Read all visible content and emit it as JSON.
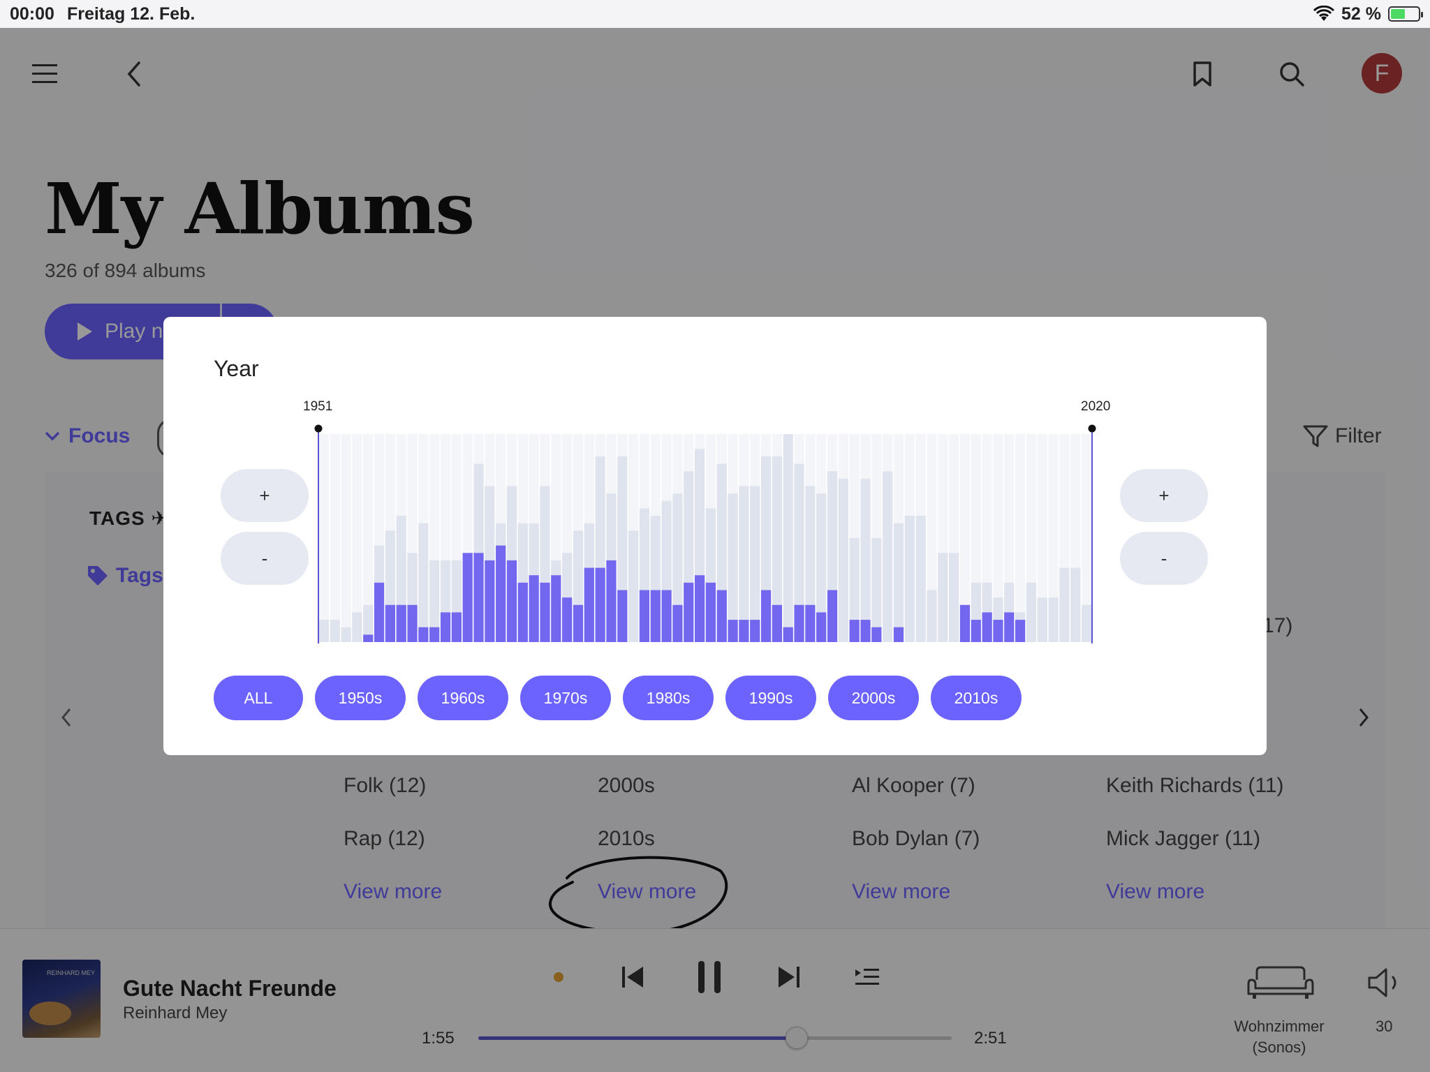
{
  "status": {
    "time": "00:00",
    "date": "Freitag 12. Feb.",
    "battery": "52 %",
    "battery_level": 0.52
  },
  "header": {
    "avatar_letter": "F",
    "title": "My Albums",
    "subtitle": "326 of 894 albums"
  },
  "actions": {
    "play_label": "Play n",
    "focus_label": "Focus",
    "filter_label": "Filter"
  },
  "tags": {
    "heading": "TAGS",
    "link_label": "Tags",
    "partial_count": "17)"
  },
  "columns": [
    {
      "items": [
        "Folk (12)",
        "Rap (12)"
      ],
      "more": "View more"
    },
    {
      "items": [
        "2000s",
        "2010s"
      ],
      "more": "View more"
    },
    {
      "items": [
        "Al Kooper (7)",
        "Bob Dylan (7)"
      ],
      "more": "View more"
    },
    {
      "items": [
        "Keith Richards (11)",
        "Mick Jagger (11)"
      ],
      "more": "View more"
    }
  ],
  "player": {
    "title": "Gute Nacht Freunde",
    "artist": "Reinhard Mey",
    "art_text": "REINHARD MEY",
    "elapsed": "1:55",
    "duration": "2:51",
    "progress": 0.672,
    "speaker": "Wohnzimmer (Sonos)",
    "volume": "30"
  },
  "modal": {
    "title": "Year",
    "range_start": "1951",
    "range_end": "2020",
    "plus_label": "+",
    "minus_label": "-",
    "decades": [
      "ALL",
      "1950s",
      "1960s",
      "1970s",
      "1980s",
      "1990s",
      "2000s",
      "2010s"
    ]
  },
  "colors": {
    "accent": "#6c63ff",
    "bar_selected": "#7367f0",
    "bar_total": "#dfe3ee",
    "bar_bg": "#f4f5f9"
  },
  "chart_data": {
    "type": "bar",
    "x": [
      1951,
      1952,
      1953,
      1954,
      1955,
      1956,
      1957,
      1958,
      1959,
      1960,
      1961,
      1962,
      1963,
      1964,
      1965,
      1966,
      1967,
      1968,
      1969,
      1970,
      1971,
      1972,
      1973,
      1974,
      1975,
      1976,
      1977,
      1978,
      1979,
      1980,
      1981,
      1982,
      1983,
      1984,
      1985,
      1986,
      1987,
      1988,
      1989,
      1990,
      1991,
      1992,
      1993,
      1994,
      1995,
      1996,
      1997,
      1998,
      1999,
      2000,
      2001,
      2002,
      2003,
      2004,
      2005,
      2006,
      2007,
      2008,
      2009,
      2010,
      2011,
      2012,
      2013,
      2014,
      2015,
      2016,
      2017,
      2018,
      2019,
      2020
    ],
    "series": [
      {
        "values": [
          3,
          3,
          2,
          4,
          5,
          13,
          15,
          17,
          12,
          16,
          11,
          11,
          11,
          11,
          24,
          21,
          16,
          21,
          16,
          16,
          21,
          11,
          12,
          15,
          16,
          25,
          20,
          25,
          15,
          18,
          17,
          19,
          20,
          23,
          26,
          18,
          24,
          20,
          21,
          21,
          25,
          25,
          28,
          24,
          21,
          20,
          23,
          22,
          14,
          22,
          14,
          23,
          16,
          17,
          17,
          7,
          12,
          12,
          4,
          8,
          8,
          6,
          8,
          4,
          8,
          6,
          6,
          10,
          10,
          5
        ]
      },
      {
        "values": [
          0,
          0,
          0,
          0,
          1,
          8,
          5,
          5,
          5,
          2,
          2,
          4,
          4,
          12,
          12,
          11,
          13,
          11,
          8,
          9,
          8,
          9,
          6,
          5,
          10,
          10,
          11,
          7,
          0,
          7,
          7,
          7,
          5,
          8,
          9,
          8,
          7,
          3,
          3,
          3,
          7,
          5,
          2,
          5,
          5,
          4,
          7,
          0,
          3,
          3,
          2,
          0,
          2,
          0,
          0,
          0,
          0,
          0,
          5,
          3,
          4,
          3,
          4,
          3,
          0,
          0,
          0,
          0,
          0,
          0
        ]
      }
    ],
    "xlim": [
      1951,
      2020
    ]
  }
}
